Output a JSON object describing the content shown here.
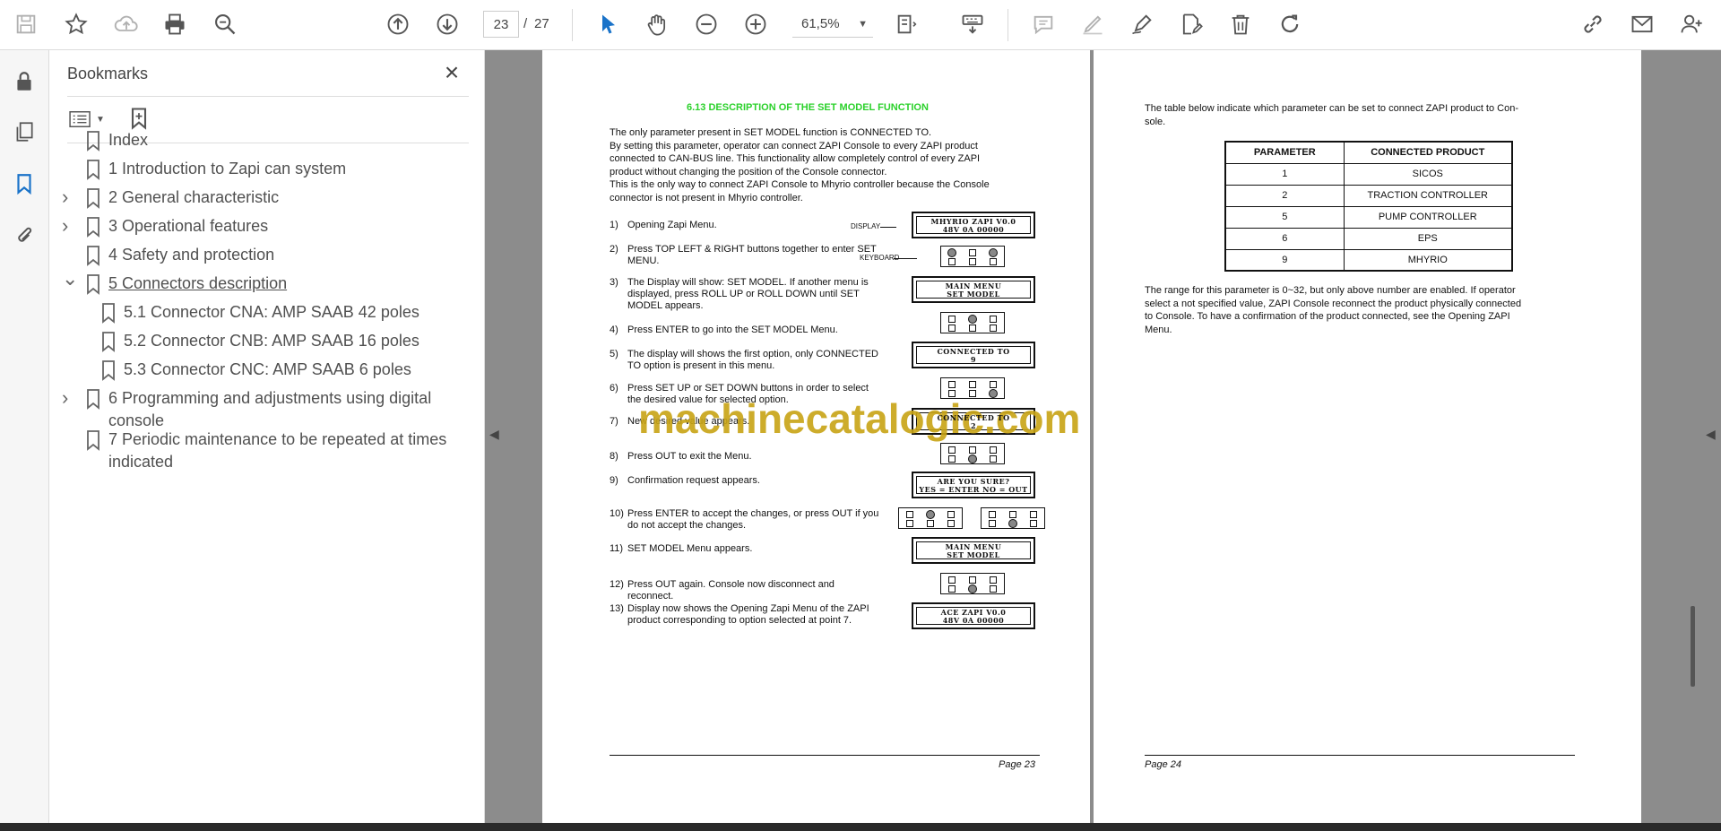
{
  "toolbar": {
    "page_current": "23",
    "page_separator": "/",
    "page_total": "27",
    "zoom": "61,5%"
  },
  "bookmarks": {
    "title": "Bookmarks",
    "items": [
      {
        "label": "Index",
        "expand": ""
      },
      {
        "label": "1 Introduction to Zapi can system",
        "expand": ""
      },
      {
        "label": "2 General characteristic",
        "expand": ">"
      },
      {
        "label": "3 Operational features",
        "expand": ">"
      },
      {
        "label": "4 Safety and protection",
        "expand": ""
      },
      {
        "label": "5 Connectors description",
        "expand": "v"
      },
      {
        "label": "5.1 Connector CNA: AMP SAAB 42 poles",
        "expand": ""
      },
      {
        "label": "5.2 Connector CNB: AMP SAAB 16 poles",
        "expand": ""
      },
      {
        "label": "5.3 Connector CNC: AMP SAAB 6 poles",
        "expand": ""
      },
      {
        "label": "6 Programming and adjustments using digital console",
        "expand": ">"
      },
      {
        "label": "7 Periodic maintenance to be repeated at times indicated",
        "expand": ""
      }
    ]
  },
  "page23": {
    "title": "6.13 DESCRIPTION OF THE SET MODEL FUNCTION",
    "intro": [
      "The only parameter present in SET MODEL function is CONNECTED TO.",
      "By setting this parameter, operator can connect ZAPI Console to every ZAPI product",
      "connected to CAN-BUS line. This functionality allow completely control of every ZAPI",
      "product without changing the position of the Console connector.",
      "This is the only way to connect ZAPI Console to Mhyrio controller because the Console",
      "connector is not present in Mhyrio controller."
    ],
    "steps": [
      {
        "num": "1)",
        "text": "Opening Zapi Menu."
      },
      {
        "num": "2)",
        "text": "Press TOP LEFT & RIGHT buttons together to enter SET MENU."
      },
      {
        "num": "3)",
        "text": "The Display will show: SET MODEL. If another menu is displayed, press ROLL UP or ROLL DOWN until SET MODEL  appears."
      },
      {
        "num": "4)",
        "text": "Press ENTER to go into the SET MODEL Menu."
      },
      {
        "num": "5)",
        "text": "The display will shows the first option, only CONNECTED TO option is present in this menu."
      },
      {
        "num": "6)",
        "text": "Press SET UP or SET DOWN buttons in order to select the desired value for selected option."
      },
      {
        "num": "7)",
        "text": "New desired value appears."
      },
      {
        "num": "8)",
        "text": "Press OUT to exit the Menu."
      },
      {
        "num": "9)",
        "text": "Confirmation request appears."
      },
      {
        "num": "10)",
        "text": "Press ENTER to accept the changes, or press OUT if you do not accept the changes."
      },
      {
        "num": "11)",
        "text": "SET MODEL Menu appears."
      },
      {
        "num": "12)",
        "text": "Press OUT again. Console now disconnect and reconnect."
      },
      {
        "num": "13)",
        "text": "Display now shows the Opening Zapi Menu of the ZAPI product corresponding to option selected at point 7."
      }
    ],
    "labels": {
      "display": "DISPLAY",
      "keyboard": "KEYBOARD"
    },
    "lcds": [
      {
        "l1": "MHYRIO ZAPI V0.0",
        "l2": "48V 0A 00000"
      },
      {
        "l1": "MAIN MENU",
        "l2": "SET MODEL"
      },
      {
        "l1": "CONNECTED TO",
        "l2": "9"
      },
      {
        "l1": "CONNECTED TO",
        "l2": "2"
      },
      {
        "l1": "ARE YOU SURE?",
        "l2": "YES = ENTER NO = OUT"
      },
      {
        "l1": "MAIN MENU",
        "l2": "SET MODEL"
      },
      {
        "l1": "ACE ZAPI V0.0",
        "l2": "48V 0A 00000"
      }
    ],
    "footer": "Page 23"
  },
  "page24": {
    "intro": [
      "The table below indicate which parameter can be set to connect ZAPI product to Con-",
      "sole."
    ],
    "table": {
      "headers": [
        "PARAMETER",
        "CONNECTED PRODUCT"
      ],
      "rows": [
        [
          "1",
          "SICOS"
        ],
        [
          "2",
          "TRACTION CONTROLLER"
        ],
        [
          "5",
          "PUMP CONTROLLER"
        ],
        [
          "6",
          "EPS"
        ],
        [
          "9",
          "MHYRIO"
        ]
      ]
    },
    "note": [
      "The range for this parameter is 0~32, but only above number are enabled. If operator",
      "select a not specified value, ZAPI Console reconnect the product physically connected",
      "to Console. To have a confirmation of the product connected, see the Opening ZAPI",
      "Menu."
    ],
    "footer": "Page 24"
  },
  "watermark": "machinecatalogic.com"
}
